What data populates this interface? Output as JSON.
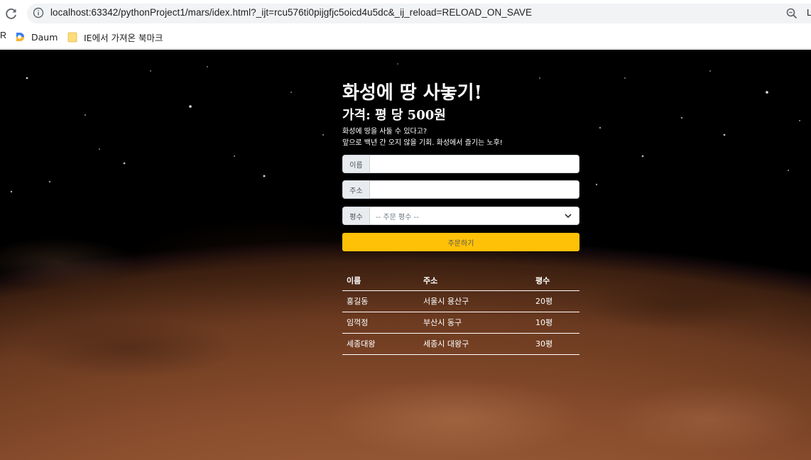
{
  "browser": {
    "url": "localhost:63342/pythonProject1/mars/idex.html?_ijt=rcu576ti0pijgfjc5oicd4u5dc&_ij_reload=RELOAD_ON_SAVE",
    "edge_glyph": "L",
    "bookmarks": {
      "cut_label": "R",
      "daum_label": "Daum",
      "folder_label": "IE에서 가져온 북마크"
    },
    "icons": [
      "reload-icon",
      "info-icon",
      "zoom-icon",
      "daum-logo",
      "folder-icon"
    ]
  },
  "page": {
    "title": "화성에 땅 사놓기!",
    "subtitle": "가격: 평 당 500원",
    "description_line1": "화성에 땅을 사둘 수 있다고?",
    "description_line2": "앞으로 백년 간 오지 않을 기회. 화성에서 즐기는 노후!",
    "form": {
      "name_label": "이름",
      "name_value": "",
      "address_label": "주소",
      "address_value": "",
      "size_label": "평수",
      "size_placeholder": "-- 주문 평수 --",
      "submit_label": "주문하기"
    },
    "table": {
      "headers": [
        "이름",
        "주소",
        "평수"
      ],
      "rows": [
        [
          "홍길동",
          "서울시 용산구",
          "20평"
        ],
        [
          "임꺽정",
          "부산시 동구",
          "10평"
        ],
        [
          "세종대왕",
          "세종시 대왕구",
          "30평"
        ]
      ]
    }
  },
  "colors": {
    "accent": "#ffc107",
    "mars": "#8c4f2e",
    "space": "#000000"
  }
}
